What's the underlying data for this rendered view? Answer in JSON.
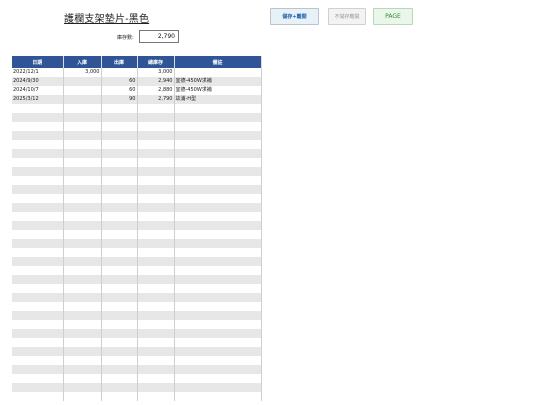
{
  "title": "護欄支架墊片-黑色",
  "toolbar": {
    "save_label": "儲存+離開",
    "unsave_label": "不儲存離開",
    "page_label": "PAGE"
  },
  "stock": {
    "label": "庫存數:",
    "value": "2,790"
  },
  "table": {
    "headers": [
      "日期",
      "入庫",
      "出庫",
      "總庫存",
      "備註"
    ],
    "rows": [
      {
        "date": "2022/12/1",
        "in": "3,000",
        "out": "",
        "stock": "3,000",
        "note": ""
      },
      {
        "date": "2024/9/30",
        "in": "",
        "out": "60",
        "stock": "2,940",
        "note": "宜德-450W求補"
      },
      {
        "date": "2024/10/7",
        "in": "",
        "out": "60",
        "stock": "2,880",
        "note": "宜德-450W求補"
      },
      {
        "date": "2025/3/12",
        "in": "",
        "out": "90",
        "stock": "2,790",
        "note": "竑浦-H型"
      },
      {
        "date": "",
        "in": "",
        "out": "",
        "stock": "",
        "note": ""
      },
      {
        "date": "",
        "in": "",
        "out": "",
        "stock": "",
        "note": ""
      },
      {
        "date": "",
        "in": "",
        "out": "",
        "stock": "",
        "note": ""
      },
      {
        "date": "",
        "in": "",
        "out": "",
        "stock": "",
        "note": ""
      },
      {
        "date": "",
        "in": "",
        "out": "",
        "stock": "",
        "note": ""
      },
      {
        "date": "",
        "in": "",
        "out": "",
        "stock": "",
        "note": ""
      },
      {
        "date": "",
        "in": "",
        "out": "",
        "stock": "",
        "note": ""
      },
      {
        "date": "",
        "in": "",
        "out": "",
        "stock": "",
        "note": ""
      },
      {
        "date": "",
        "in": "",
        "out": "",
        "stock": "",
        "note": ""
      },
      {
        "date": "",
        "in": "",
        "out": "",
        "stock": "",
        "note": ""
      },
      {
        "date": "",
        "in": "",
        "out": "",
        "stock": "",
        "note": ""
      },
      {
        "date": "",
        "in": "",
        "out": "",
        "stock": "",
        "note": ""
      },
      {
        "date": "",
        "in": "",
        "out": "",
        "stock": "",
        "note": ""
      },
      {
        "date": "",
        "in": "",
        "out": "",
        "stock": "",
        "note": ""
      },
      {
        "date": "",
        "in": "",
        "out": "",
        "stock": "",
        "note": ""
      },
      {
        "date": "",
        "in": "",
        "out": "",
        "stock": "",
        "note": ""
      },
      {
        "date": "",
        "in": "",
        "out": "",
        "stock": "",
        "note": ""
      },
      {
        "date": "",
        "in": "",
        "out": "",
        "stock": "",
        "note": ""
      },
      {
        "date": "",
        "in": "",
        "out": "",
        "stock": "",
        "note": ""
      },
      {
        "date": "",
        "in": "",
        "out": "",
        "stock": "",
        "note": ""
      },
      {
        "date": "",
        "in": "",
        "out": "",
        "stock": "",
        "note": ""
      },
      {
        "date": "",
        "in": "",
        "out": "",
        "stock": "",
        "note": ""
      },
      {
        "date": "",
        "in": "",
        "out": "",
        "stock": "",
        "note": ""
      },
      {
        "date": "",
        "in": "",
        "out": "",
        "stock": "",
        "note": ""
      },
      {
        "date": "",
        "in": "",
        "out": "",
        "stock": "",
        "note": ""
      },
      {
        "date": "",
        "in": "",
        "out": "",
        "stock": "",
        "note": ""
      },
      {
        "date": "",
        "in": "",
        "out": "",
        "stock": "",
        "note": ""
      },
      {
        "date": "",
        "in": "",
        "out": "",
        "stock": "",
        "note": ""
      },
      {
        "date": "",
        "in": "",
        "out": "",
        "stock": "",
        "note": ""
      },
      {
        "date": "",
        "in": "",
        "out": "",
        "stock": "",
        "note": ""
      },
      {
        "date": "",
        "in": "",
        "out": "",
        "stock": "",
        "note": ""
      },
      {
        "date": "",
        "in": "",
        "out": "",
        "stock": "",
        "note": ""
      },
      {
        "date": "",
        "in": "",
        "out": "",
        "stock": "",
        "note": ""
      }
    ]
  },
  "colors": {
    "header_bg": "#2f5597",
    "header_text": "#ffffff",
    "row_alt": "#e7e7e7",
    "save_text": "#1f5fa8",
    "page_text": "#3a8a3a"
  }
}
